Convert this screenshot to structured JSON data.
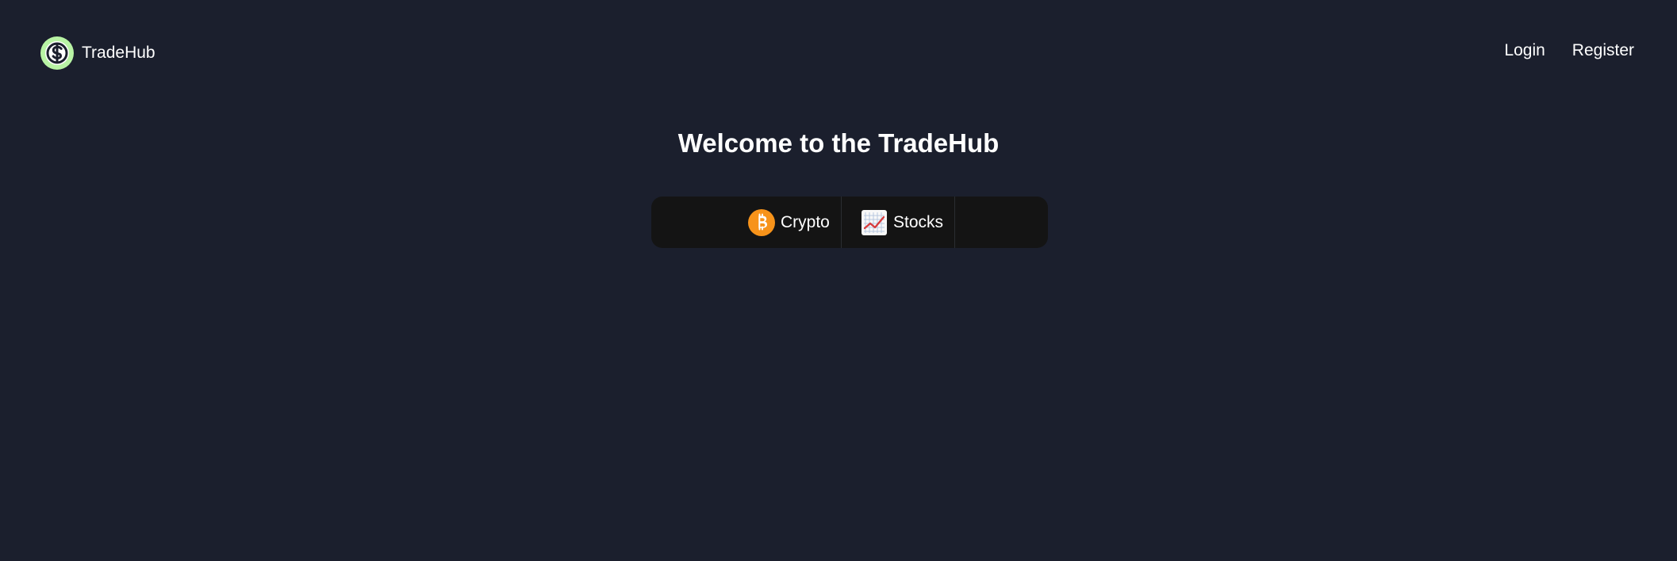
{
  "header": {
    "brand_name": "TradeHub",
    "nav": {
      "login_label": "Login",
      "register_label": "Register"
    }
  },
  "main": {
    "title": "Welcome to the TradeHub",
    "markets": [
      {
        "label": "Crypto",
        "icon": "bitcoin-icon"
      },
      {
        "label": "Stocks",
        "icon": "stock-chart-icon"
      }
    ]
  },
  "colors": {
    "background": "#1b1f2d",
    "market_bar": "#141414",
    "brand_logo_green": "#b8f3a4",
    "bitcoin_orange": "#f7931a",
    "chart_red": "#d83b3b"
  }
}
